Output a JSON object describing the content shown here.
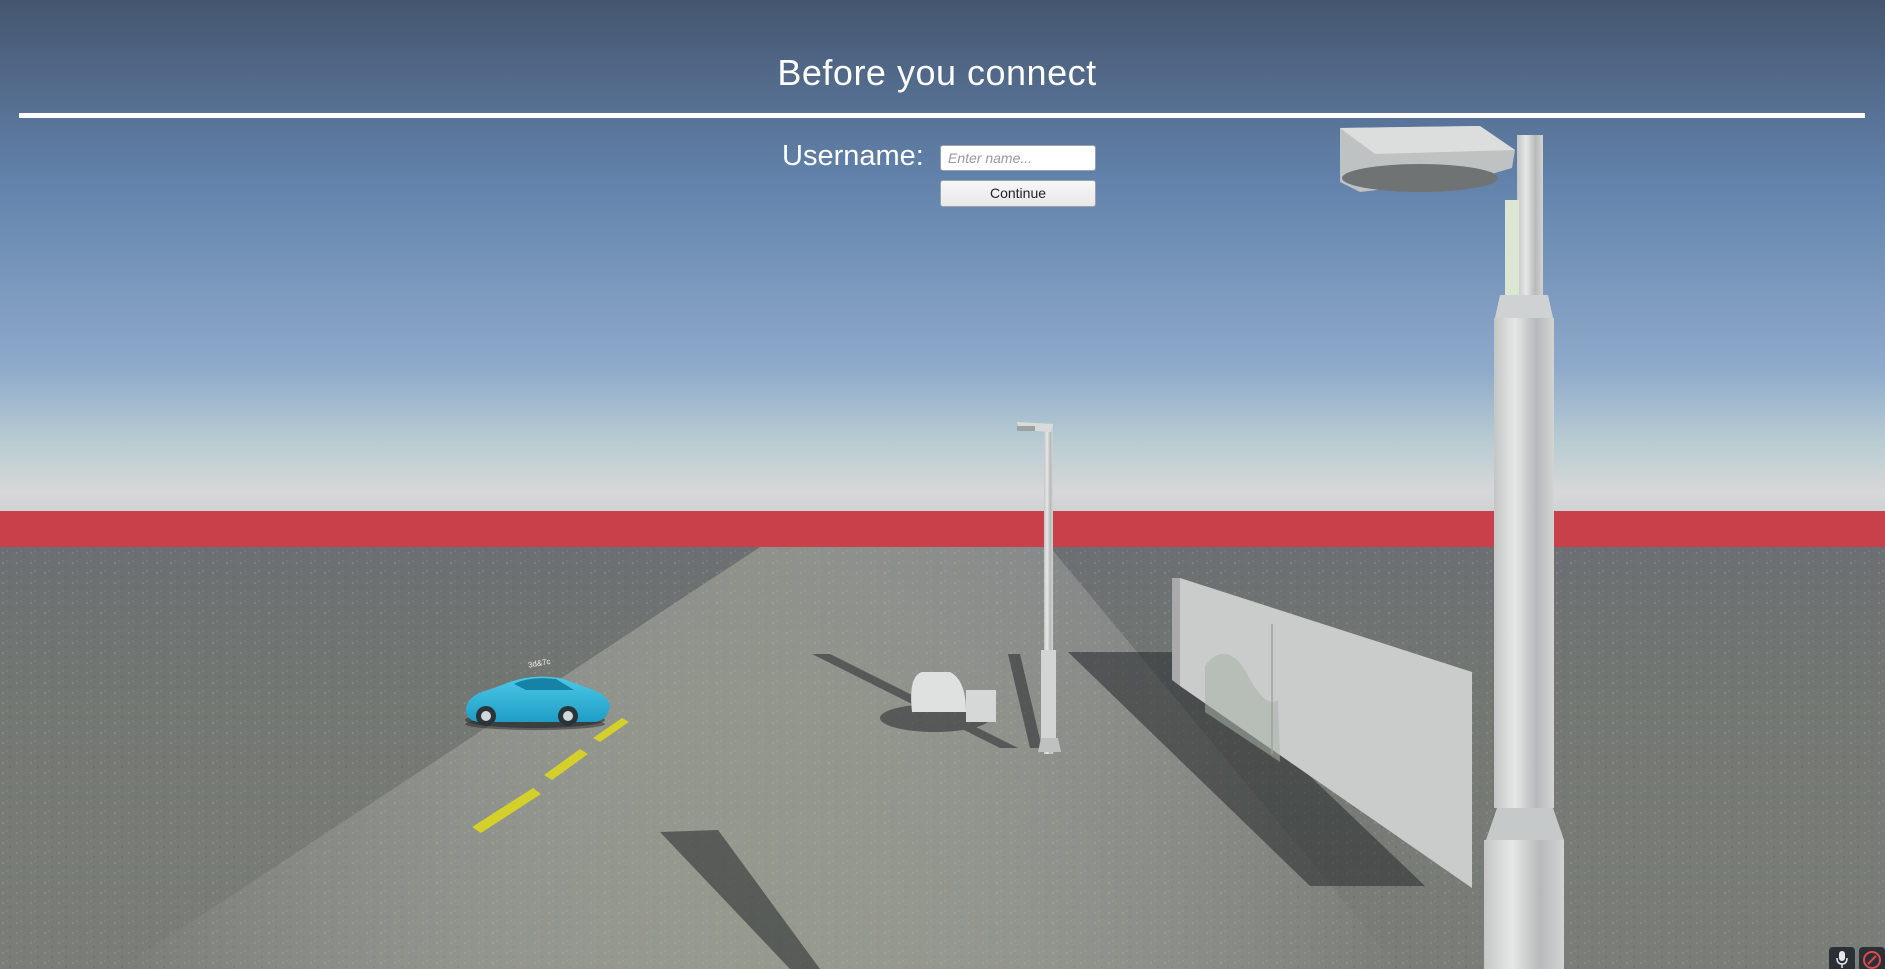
{
  "dialog": {
    "title": "Before you connect",
    "username_label": "Username:",
    "username_value": "",
    "username_placeholder": "Enter name...",
    "continue_label": "Continue"
  },
  "scene": {
    "car_label": "3d&7c",
    "colors": {
      "sky_top": "#46587a",
      "sky_mid": "#7f9fc3",
      "horizon_band": "#c63a44",
      "ground": "#6d706c",
      "car": "#2fb6dc",
      "lamp": "#cfd2d2",
      "wall": "#c9c9c9",
      "road_line": "#d8d22c"
    }
  },
  "corner_tools": {
    "icons": [
      "microphone-icon",
      "record-icon"
    ]
  }
}
